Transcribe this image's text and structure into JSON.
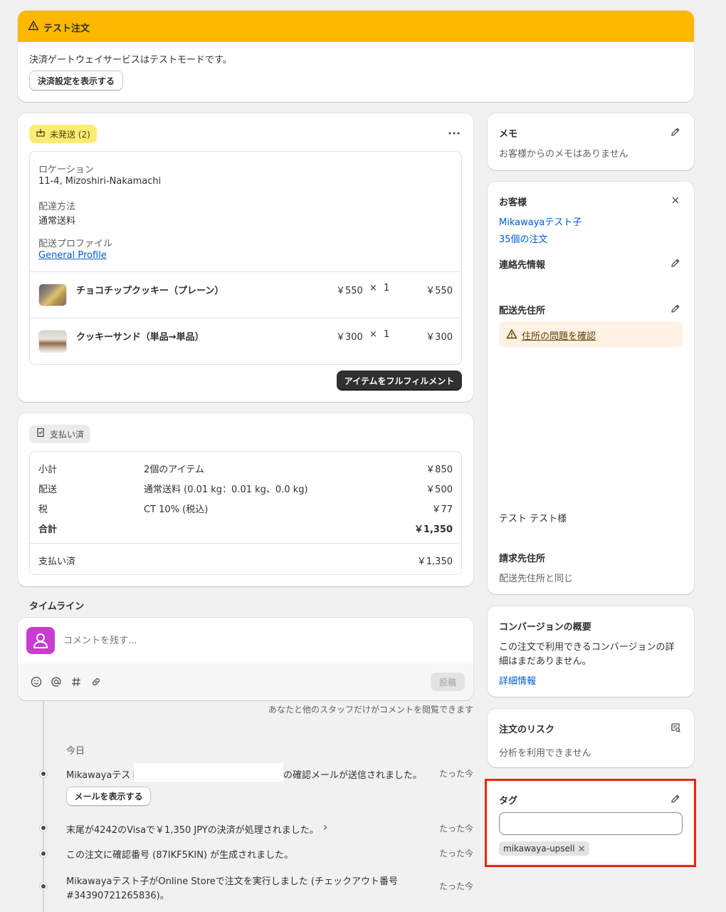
{
  "test_banner": {
    "title": "テスト注文",
    "message": "決済ゲートウェイサービスはテストモードです。",
    "button_label": "決済設定を表示する"
  },
  "fulfillment": {
    "badge": "未発送 (2)",
    "location_label": "ロケーション",
    "location_value": "11-4, Mizoshiri-Nakamachi",
    "shipping_method_label": "配達方法",
    "shipping_method_value": "通常送料",
    "profile_label": "配送プロファイル",
    "profile_value": "General Profile",
    "items": [
      {
        "name": "チョコチップクッキー（プレーン）",
        "price": "￥550",
        "times": "×",
        "qty": "1",
        "total": "￥550"
      },
      {
        "name": "クッキーサンド（単品→単品）",
        "price": "￥300",
        "times": "×",
        "qty": "1",
        "total": "￥300"
      }
    ],
    "fulfill_button": "アイテムをフルフィルメント"
  },
  "payment": {
    "badge": "支払い済",
    "rows": [
      {
        "label": "小計",
        "desc": "2個のアイテム",
        "value": "￥850"
      },
      {
        "label": "配送",
        "desc": "通常送料 (0.01 kg：0.01 kg、0.0 kg)",
        "value": "￥500"
      },
      {
        "label": "税",
        "desc": "CT 10% (税込)",
        "value": "￥77"
      },
      {
        "label": "合計",
        "desc": "",
        "value": "￥1,350"
      }
    ],
    "paid_label": "支払い済",
    "paid_value": "￥1,350"
  },
  "timeline": {
    "heading": "タイムライン",
    "comment_placeholder": "コメントを残す...",
    "post_button": "投稿",
    "visibility_note": "あなたと他のスタッフだけがコメントを閲覧できます",
    "day_label": "今日",
    "events": [
      {
        "text_prefix": "Mikawayaテスト",
        "text_suffix": "の確認メールが送信されました。",
        "time": "たった今",
        "button": "メールを表示する"
      },
      {
        "text": "末尾が4242のVisaで￥1,350 JPYの決済が処理されました。",
        "chevron": "›",
        "time": "たった今"
      },
      {
        "text": "この注文に確認番号 (87IKF5KIN) が生成されました。",
        "time": "たった今"
      },
      {
        "text_line1": "Mikawayaテスト子がOnline Storeで注文を実行しました (チェックアウト番号",
        "text_line2": "#34390721265836)。",
        "time": "たった今"
      }
    ]
  },
  "memo": {
    "title": "メモ",
    "text": "お客様からのメモはありません"
  },
  "customer": {
    "title": "お客様",
    "name": "Mikawayaテスト子",
    "orders": "35個の注文",
    "contact_title": "連絡先情報",
    "shipping_title": "配送先住所",
    "address_warning": "住所の問題を確認",
    "recipient": "テスト テスト様",
    "billing_title": "請求先住所",
    "billing_value": "配送先住所と同じ"
  },
  "conversion": {
    "title": "コンバージョンの概要",
    "text_line1": "この注文で利用できるコンバージョンの詳",
    "text_line2": "細はまだありません。",
    "link": "詳細情報"
  },
  "risk": {
    "title": "注文のリスク",
    "text": "分析を利用できません"
  },
  "tags": {
    "title": "タグ",
    "input_value": "",
    "chips": [
      "mikawaya-upsell"
    ],
    "highlight_color": "#e8290b"
  },
  "colors": {
    "banner": "#ffb800",
    "unfulfilled_badge": "#ffeb78",
    "primary_button": "#303030",
    "link": "#005bd3",
    "avatar": "#c83cd0"
  }
}
